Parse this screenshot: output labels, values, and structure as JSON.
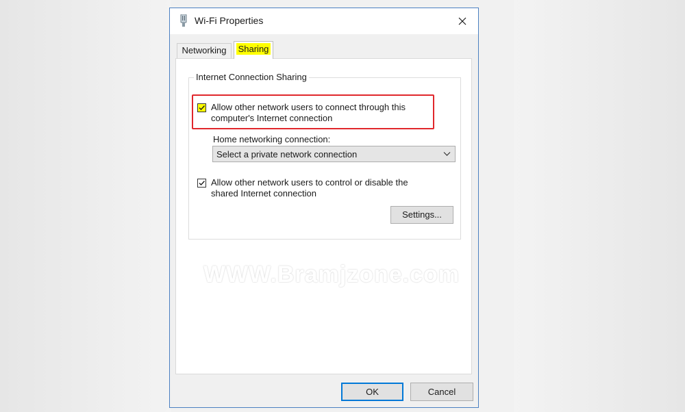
{
  "window": {
    "title": "Wi-Fi Properties",
    "icon": "network-adapter-icon"
  },
  "tabs": [
    {
      "label": "Networking",
      "active": false
    },
    {
      "label": "Sharing",
      "active": true
    }
  ],
  "sharing": {
    "group_label": "Internet Connection Sharing",
    "allow_connect": {
      "label": "Allow other network users to connect through this computer's Internet connection",
      "checked": true
    },
    "home_connection_label": "Home networking connection:",
    "home_connection_select": {
      "value": "Select a private network connection"
    },
    "allow_control": {
      "label": "Allow other network users to control or disable the shared Internet connection",
      "checked": true
    },
    "settings_label": "Settings..."
  },
  "watermark": "WWW.Bramjzone.com",
  "footer": {
    "ok_label": "OK",
    "cancel_label": "Cancel"
  },
  "colors": {
    "highlight": "#ffff00",
    "annotation_red": "#e0262b",
    "window_border": "#4a7fc1",
    "default_button_border": "#0078d7"
  }
}
